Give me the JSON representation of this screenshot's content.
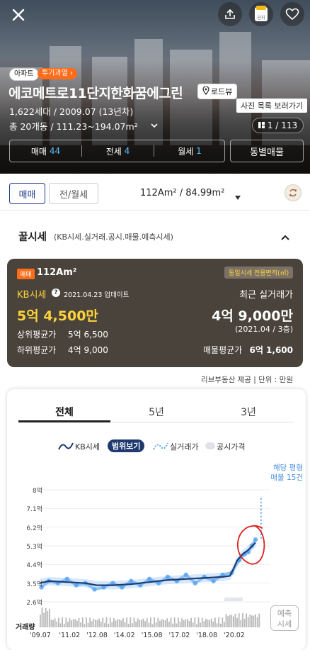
{
  "header": {
    "type_badge": "아파트",
    "zone_badge": "투기과열 ›",
    "title": "에코메트로11단지한화꿈에그린",
    "roadview": "로드뷰",
    "households_year": "1,622세대 / 2009.07 (13년차)",
    "buildings_area": "총 20개동 / 111.23~194.07m²",
    "photo_tooltip": "사진 목록 보러가기",
    "photo_counter": "1 / 113",
    "report_label": "단지"
  },
  "listing_tabs": {
    "sale_label": "매매",
    "sale_count": "44",
    "jeonse_label": "전세",
    "jeonse_count": "4",
    "monthly_label": "월세",
    "monthly_count": "1",
    "by_building": "동별매물"
  },
  "filters": {
    "sale": "매매",
    "rent": "전/월세",
    "area": "112Am² / 84.99m²"
  },
  "section": {
    "title": "꿀시세",
    "subtitle": "(KB시세.실거래.공시.매물.예측시세)"
  },
  "price_card": {
    "badge": "매매",
    "area": "112Am²",
    "exclusive_badge": "동일시세 전용면적(㎡)",
    "kb_label": "KB시세",
    "kb_update": "2021.04.23 업데이트",
    "kb_price": "5억 4,500만",
    "upper_label": "상위평균가",
    "upper_value": "5억 6,500",
    "lower_label": "하위평균가",
    "lower_value": "4억 9,000",
    "recent_label": "최근 실거래가",
    "recent_price": "4억 9,000만",
    "recent_date": "(2021.04 / 3층)",
    "listing_avg_label": "매물평균가",
    "listing_avg_value": "6억 1,600"
  },
  "provider": "리브부동산 제공  |  단위 : 만원",
  "chart_tabs": {
    "all": "전체",
    "five": "5년",
    "three": "3년"
  },
  "legend": {
    "kb": "KB시세",
    "range": "범위보기",
    "trade": "실거래가",
    "public": "공시가격"
  },
  "listing_note": {
    "line1": "해당 평형",
    "line2": "매물 15건"
  },
  "volume_label": "거래량",
  "forecast_button": {
    "line1": "예측",
    "line2": "시세"
  },
  "colors": {
    "accent": "#1f3a8a",
    "kb_line": "#1e3a6e",
    "trade_dots": "#5aa6f2",
    "gold": "#ffd43b",
    "orange": "#ff7a1a"
  },
  "chart_data": {
    "type": "line",
    "x_ticks": [
      "'09.07",
      "'11.02",
      "'12.08",
      "'14.02",
      "'15.08",
      "'17.02",
      "'18.08",
      "'20.02"
    ],
    "y_ticks": [
      "8억",
      "7.1억",
      "6.2억",
      "5.3억",
      "4.4억",
      "3.5억",
      "2.6억"
    ],
    "ylim": [
      2.6,
      8
    ],
    "series": [
      {
        "name": "KB시세",
        "x": [
          2009.5,
          2010.0,
          2011.0,
          2012.0,
          2012.6,
          2013.5,
          2014.5,
          2015.5,
          2016.5,
          2017.5,
          2018.5,
          2019.5,
          2019.9,
          2020.1,
          2020.3,
          2020.6,
          2020.9,
          2021.3
        ],
        "y": [
          3.5,
          3.6,
          3.55,
          3.5,
          3.4,
          3.4,
          3.45,
          3.55,
          3.65,
          3.7,
          3.75,
          3.8,
          3.85,
          4.2,
          4.6,
          4.9,
          5.1,
          5.45
        ]
      },
      {
        "name": "실거래가",
        "x": [
          2009.6,
          2010.0,
          2010.5,
          2011.0,
          2011.5,
          2012.0,
          2012.5,
          2013.0,
          2013.5,
          2014.0,
          2014.5,
          2015.0,
          2015.5,
          2016.0,
          2016.5,
          2017.0,
          2017.5,
          2018.0,
          2018.5,
          2019.0,
          2019.5,
          2020.0,
          2020.4,
          2020.7,
          2020.9,
          2021.1,
          2021.3
        ],
        "y": [
          3.3,
          3.6,
          3.5,
          3.7,
          3.4,
          3.5,
          3.2,
          3.3,
          3.5,
          3.3,
          3.6,
          3.4,
          3.7,
          3.5,
          3.8,
          3.6,
          3.9,
          3.5,
          3.8,
          3.6,
          3.9,
          4.0,
          4.6,
          4.9,
          5.0,
          5.3,
          5.6
        ]
      }
    ]
  }
}
